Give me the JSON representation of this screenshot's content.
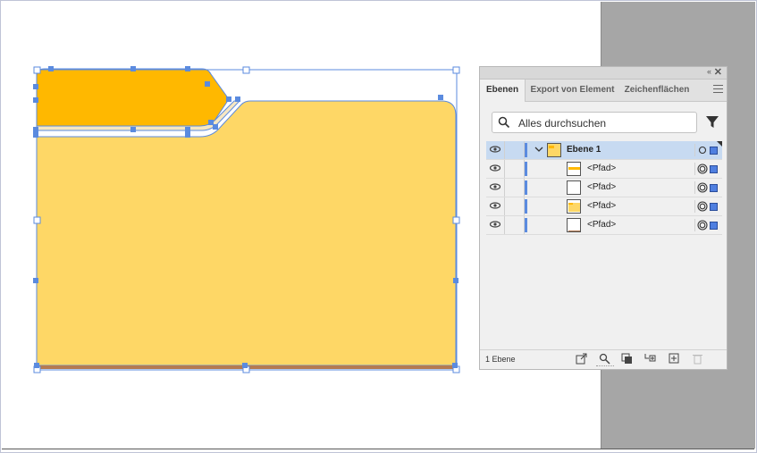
{
  "panel": {
    "collapse_glyph": "‹‹",
    "close_glyph": "✕",
    "tabs": [
      {
        "label": "Ebenen"
      },
      {
        "label": "Export von Element"
      },
      {
        "label": "Zeichenflächen"
      }
    ],
    "search": {
      "placeholder": "Alles durchsuchen"
    },
    "layers": [
      {
        "name": "Ebene 1",
        "kind": "layer",
        "selected": true,
        "thumb": "folder"
      },
      {
        "name": "<Pfad>",
        "kind": "path",
        "thumb": "tab-stripe"
      },
      {
        "name": "<Pfad>",
        "kind": "path",
        "thumb": "blank"
      },
      {
        "name": "<Pfad>",
        "kind": "path",
        "thumb": "folder-body"
      },
      {
        "name": "<Pfad>",
        "kind": "path",
        "thumb": "blank"
      }
    ],
    "footer": {
      "count": "1 Ebene",
      "buttons": [
        "export-icon",
        "search-icon",
        "clipping-mask-icon",
        "new-sublayer-icon",
        "new-layer-icon",
        "delete-icon"
      ]
    }
  },
  "colors": {
    "folder_tab": "#ffb800",
    "folder_body": "#fed766",
    "folder_stripe": "#f6e7c2",
    "folder_bottom": "#b47a52",
    "selection": "#5b8bdf",
    "layer_selected_bg": "#c7daf1"
  }
}
